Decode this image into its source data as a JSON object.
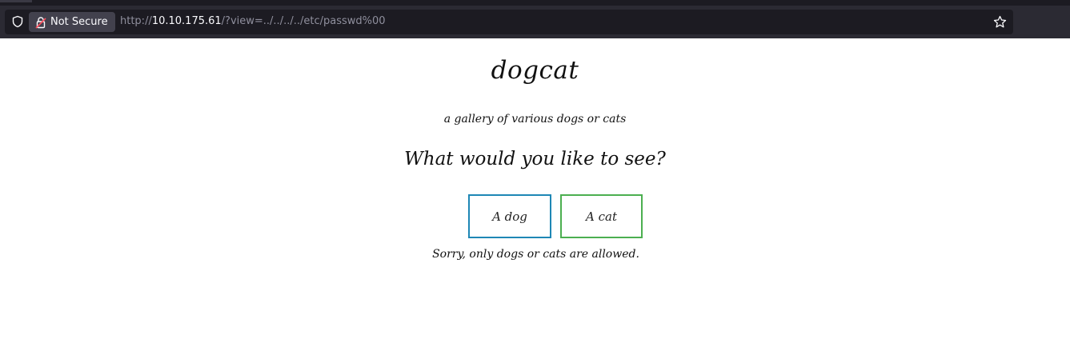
{
  "browser": {
    "security_label": "Not Secure",
    "url_scheme": "http://",
    "url_host": "10.10.175.61",
    "url_path": "/?view=../../../../etc/passwd%00",
    "icons": [
      "shield-icon",
      "lock-icon",
      "star-icon"
    ]
  },
  "page": {
    "title": "dogcat",
    "subtitle": "a gallery of various dogs or cats",
    "prompt": "What would you like to see?",
    "buttons": {
      "dog_label": "A dog",
      "cat_label": "A cat"
    },
    "error_message": "Sorry, only dogs or cats are allowed."
  },
  "colors": {
    "dog_button_border": "#1e87b5",
    "cat_button_border": "#4caf50",
    "browser_chrome": "#2b2a33",
    "url_bar": "#1c1b22"
  }
}
